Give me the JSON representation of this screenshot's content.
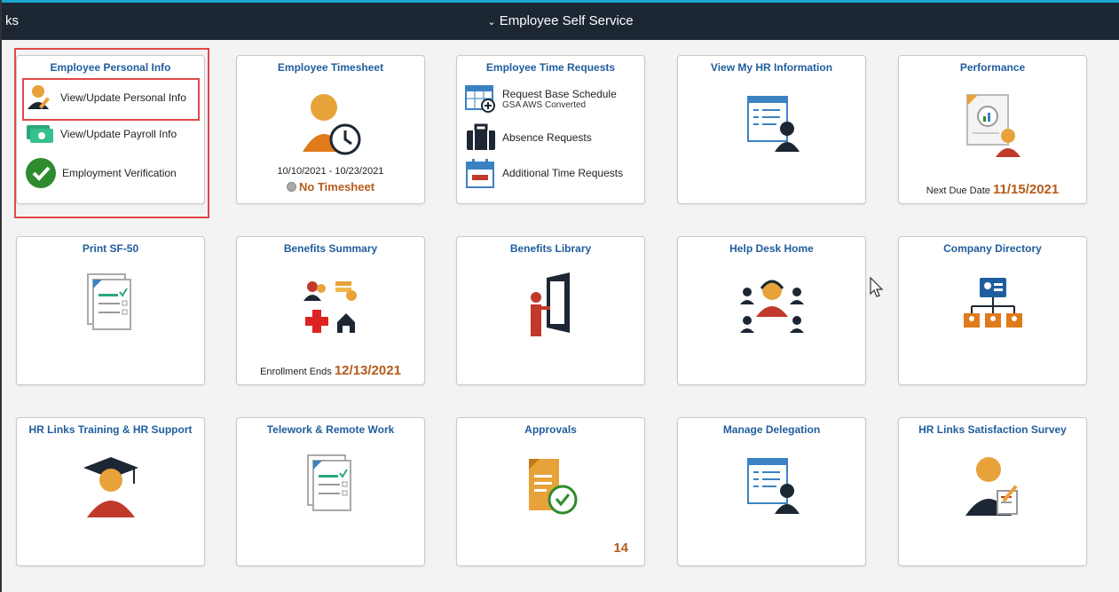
{
  "topbar": {
    "left_label": "ks",
    "title": "Employee Self Service"
  },
  "tiles": {
    "personal": {
      "title": "Employee Personal Info",
      "links": [
        "View/Update Personal Info",
        "View/Update Payroll Info",
        "Employment Verification"
      ]
    },
    "timesheet": {
      "title": "Employee Timesheet",
      "range": "10/10/2021 - 10/23/2021",
      "status": "No Timesheet"
    },
    "time_requests": {
      "title": "Employee Time Requests",
      "links": [
        {
          "label": "Request Base Schedule",
          "sub": "GSA AWS Converted"
        },
        {
          "label": "Absence Requests",
          "sub": ""
        },
        {
          "label": "Additional Time Requests",
          "sub": ""
        }
      ]
    },
    "hr_info": {
      "title": "View My HR Information"
    },
    "performance": {
      "title": "Performance",
      "due_label": "Next Due Date",
      "due_value": "11/15/2021"
    },
    "sf50": {
      "title": "Print SF-50"
    },
    "benefits_summary": {
      "title": "Benefits Summary",
      "enroll_label": "Enrollment Ends",
      "enroll_value": "12/13/2021"
    },
    "benefits_library": {
      "title": "Benefits Library"
    },
    "help_desk": {
      "title": "Help Desk Home"
    },
    "company_directory": {
      "title": "Company Directory"
    },
    "training": {
      "title": "HR Links Training & HR Support"
    },
    "telework": {
      "title": "Telework & Remote Work"
    },
    "approvals": {
      "title": "Approvals",
      "count": "14"
    },
    "delegation": {
      "title": "Manage Delegation"
    },
    "survey": {
      "title": "HR Links Satisfaction Survey"
    }
  },
  "colors": {
    "accent_blue": "#1f5e9e",
    "orange": "#e8a23a",
    "green": "#2e8b2e",
    "red": "#c0392b",
    "highlight": "#e04848"
  }
}
